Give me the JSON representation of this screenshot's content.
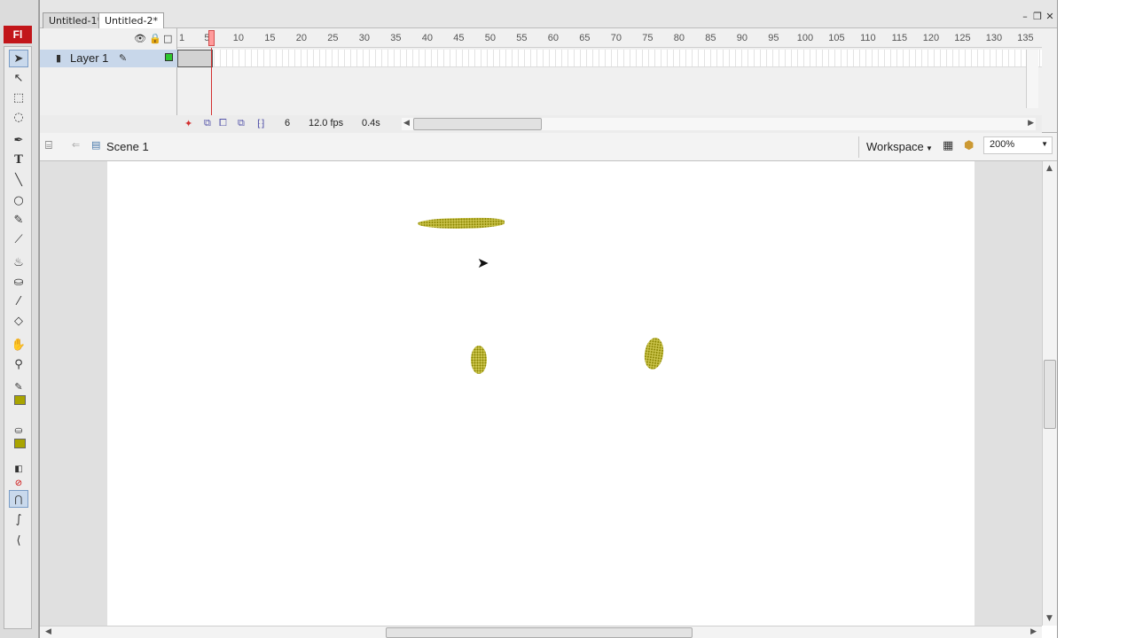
{
  "app": {
    "logo": "Fl"
  },
  "doc_tabs": [
    "Untitled-1*",
    "Untitled-2*"
  ],
  "window_buttons": {
    "minimize": "–",
    "restore": "❐",
    "close": "✕"
  },
  "timeline": {
    "layer_name": "Layer 1",
    "ruler_ticks": [
      "1",
      "5",
      "10",
      "15",
      "20",
      "25",
      "30",
      "35",
      "40",
      "45",
      "50",
      "55",
      "60",
      "65",
      "70",
      "75",
      "80",
      "85",
      "90",
      "95",
      "100",
      "105",
      "110",
      "115",
      "120",
      "125",
      "130",
      "135"
    ],
    "current_frame": "6",
    "frame_rate": "12.0 fps",
    "elapsed_time": "0.4s"
  },
  "editbar": {
    "scene": "Scene 1",
    "workspace": "Workspace",
    "zoom": "200%"
  },
  "colors": {
    "fill": "#a9a400",
    "stroke": "#a9a400",
    "logo_bg": "#c2161a",
    "playhead": "#d23030"
  }
}
